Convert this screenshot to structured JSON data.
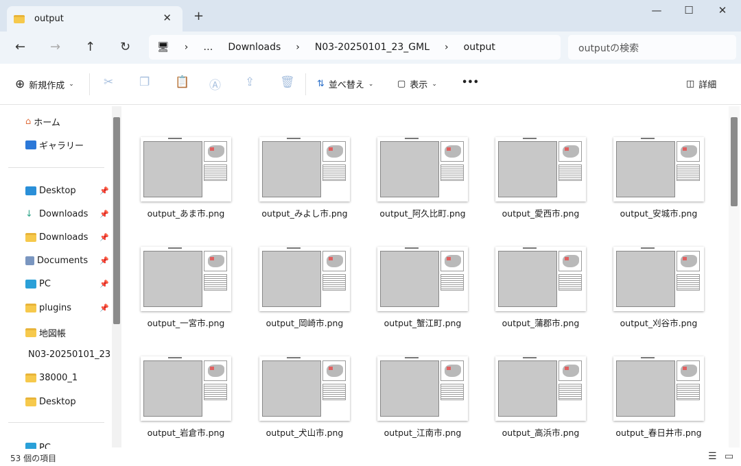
{
  "window": {
    "tab_title": "output",
    "close": "✕",
    "new_tab": "+",
    "minimize": "—",
    "maximize": "☐",
    "close_window": "✕"
  },
  "nav": {
    "back": "←",
    "forward": "→",
    "up": "↑",
    "refresh": "↻",
    "breadcrumb": [
      "…",
      "Downloads",
      "N03-20250101_23_GML",
      "output"
    ],
    "search_placeholder": "outputの検索"
  },
  "toolbar": {
    "new": "新規作成",
    "sort": "並べ替え",
    "view": "表示",
    "more": "•••",
    "details": "詳細"
  },
  "sidebar": {
    "items": [
      {
        "label": "ホーム"
      },
      {
        "label": "ギャラリー"
      },
      {
        "label": "Desktop",
        "pinned": true
      },
      {
        "label": "Downloads",
        "pinned": true
      },
      {
        "label": "Downloads",
        "pinned": true
      },
      {
        "label": "Documents",
        "pinned": true
      },
      {
        "label": "PC",
        "pinned": true
      },
      {
        "label": "plugins",
        "pinned": true
      },
      {
        "label": "地図帳"
      },
      {
        "label": "N03-20250101_23"
      },
      {
        "label": "38000_1"
      },
      {
        "label": "Desktop"
      },
      {
        "label": "PC"
      }
    ]
  },
  "files": [
    "output_あま市.png",
    "output_みよし市.png",
    "output_阿久比町.png",
    "output_愛西市.png",
    "output_安城市.png",
    "output_一宮市.png",
    "output_岡崎市.png",
    "output_蟹江町.png",
    "output_蒲郡市.png",
    "output_刈谷市.png",
    "output_岩倉市.png",
    "output_犬山市.png",
    "output_江南市.png",
    "output_高浜市.png",
    "output_春日井市.png"
  ],
  "status": {
    "count": "53 個の項目"
  }
}
